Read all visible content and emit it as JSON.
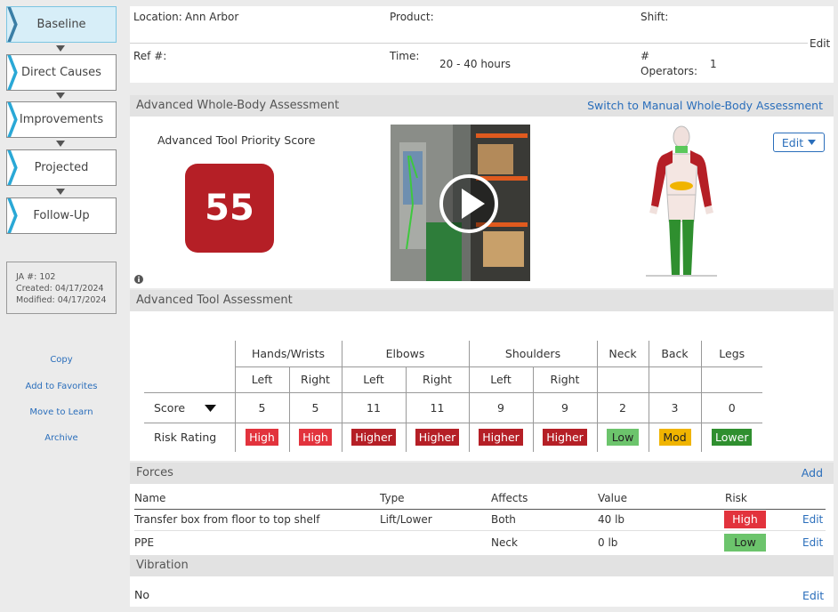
{
  "sidebar": {
    "steps": [
      "Baseline",
      "Direct Causes",
      "Improvements",
      "Projected",
      "Follow-Up"
    ],
    "meta": {
      "ja": "JA #: 102",
      "created": "Created: 04/17/2024",
      "modified": "Modified: 04/17/2024"
    },
    "links": [
      "Copy",
      "Add to Favorites",
      "Move to Learn",
      "Archive"
    ]
  },
  "info": {
    "location_label": "Location:",
    "location_value": "Ann Arbor",
    "product_label": "Product:",
    "shift_label": "Shift:",
    "ref_label": "Ref #:",
    "time_label": "Time:",
    "time_value": "20 - 40 hours",
    "operators_label_1": "#",
    "operators_label_2": "Operators:",
    "operators_value": "1",
    "edit": "Edit"
  },
  "wholebody": {
    "title": "Advanced Whole-Body Assessment",
    "switch_link": "Switch to Manual Whole-Body Assessment",
    "score_label": "Advanced Tool Priority Score",
    "score": "55",
    "edit": "Edit",
    "info_icon": "info-icon"
  },
  "tool_assessment": {
    "title": "Advanced Tool Assessment",
    "groups": [
      "Hands/Wrists",
      "Elbows",
      "Shoulders",
      "Neck",
      "Back",
      "Legs"
    ],
    "sides": [
      "Left",
      "Right",
      "Left",
      "Right",
      "Left",
      "Right"
    ],
    "score_label": "Score",
    "risk_label": "Risk Rating",
    "scores": [
      "5",
      "5",
      "11",
      "11",
      "9",
      "9",
      "2",
      "3",
      "0"
    ],
    "ratings": [
      "High",
      "High",
      "Higher",
      "Higher",
      "Higher",
      "Higher",
      "Low",
      "Mod",
      "Lower"
    ],
    "rating_colors": [
      "#e2333d",
      "#e2333d",
      "#b51f26",
      "#b51f26",
      "#b51f26",
      "#b51f26",
      "#6cc46c",
      "#f0b400",
      "#2f8f2f"
    ]
  },
  "forces": {
    "title": "Forces",
    "add": "Add",
    "headers": [
      "Name",
      "Type",
      "Affects",
      "Value",
      "Risk"
    ],
    "rows": [
      {
        "name": "Transfer box from floor to top shelf",
        "type": "Lift/Lower",
        "affects": "Both",
        "value": "40 lb",
        "risk": "High",
        "edit": "Edit"
      },
      {
        "name": "PPE",
        "type": "",
        "affects": "Neck",
        "value": "0 lb",
        "risk": "Low",
        "edit": "Edit"
      }
    ]
  },
  "vibration": {
    "title": "Vibration",
    "value": "No",
    "edit": "Edit"
  }
}
